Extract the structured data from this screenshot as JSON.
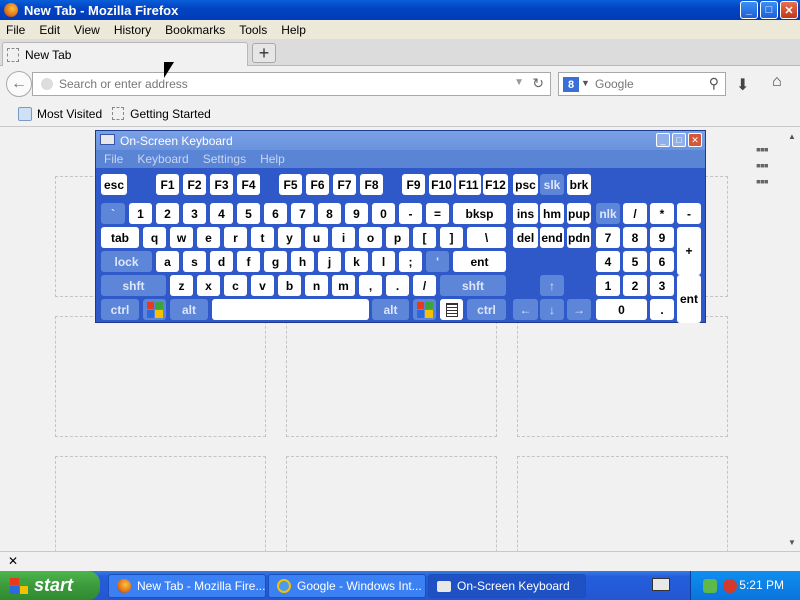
{
  "window": {
    "title": "New Tab - Mozilla Firefox"
  },
  "menu": [
    "File",
    "Edit",
    "View",
    "History",
    "Bookmarks",
    "Tools",
    "Help"
  ],
  "tab": {
    "label": "New Tab",
    "new_tab": "+"
  },
  "nav": {
    "url_placeholder": "Search or enter address",
    "search_engine": "Google",
    "search_badge": "8"
  },
  "bookmarks": [
    "Most Visited",
    "Getting Started"
  ],
  "osk": {
    "title": "On-Screen Keyboard",
    "menu": [
      "File",
      "Keyboard",
      "Settings",
      "Help"
    ],
    "keys": {
      "esc": "esc",
      "f1": "F1",
      "f2": "F2",
      "f3": "F3",
      "f4": "F4",
      "f5": "F5",
      "f6": "F6",
      "f7": "F7",
      "f8": "F8",
      "f9": "F9",
      "f10": "F10",
      "f11": "F11",
      "f12": "F12",
      "psc": "psc",
      "slk": "slk",
      "brk": "brk",
      "tick": "`",
      "k1": "1",
      "k2": "2",
      "k3": "3",
      "k4": "4",
      "k5": "5",
      "k6": "6",
      "k7": "7",
      "k8": "8",
      "k9": "9",
      "k0": "0",
      "minus": "-",
      "equals": "=",
      "bksp": "bksp",
      "ins": "ins",
      "hm": "hm",
      "pup": "pup",
      "nlk": "nlk",
      "slash": "/",
      "star": "*",
      "nminus": "-",
      "tab": "tab",
      "q": "q",
      "w": "w",
      "e": "e",
      "r": "r",
      "t": "t",
      "y": "y",
      "u": "u",
      "i": "i",
      "o": "o",
      "p": "p",
      "lbr": "[",
      "rbr": "]",
      "bslash": "\\",
      "del": "del",
      "end": "end",
      "pdn": "pdn",
      "n7": "7",
      "n8": "8",
      "n9": "9",
      "plus": "+",
      "lock": "lock",
      "a": "a",
      "s": "s",
      "d": "d",
      "f": "f",
      "g": "g",
      "h": "h",
      "j": "j",
      "k": "k",
      "l": "l",
      "semi": ";",
      "quote": "'",
      "ent": "ent",
      "n4": "4",
      "n5": "5",
      "n6": "6",
      "shft": "shft",
      "z": "z",
      "x": "x",
      "c": "c",
      "v": "v",
      "b": "b",
      "n": "n",
      "m": "m",
      "comma": ",",
      "period": ".",
      "fslash": "/",
      "rshft": "shft",
      "up": "↑",
      "n1": "1",
      "n2": "2",
      "n3": "3",
      "nent": "ent",
      "ctrl": "ctrl",
      "alt": "alt",
      "ralt": "alt",
      "rctrl": "ctrl",
      "left": "←",
      "down": "↓",
      "right": "→",
      "n0": "0",
      "ndot": "."
    }
  },
  "taskbar": {
    "start": "start",
    "tasks": [
      "New Tab - Mozilla Fire...",
      "Google - Windows Int...",
      "On-Screen Keyboard"
    ],
    "time": "5:21 PM"
  },
  "colors": {
    "xp_blue": "#245edb",
    "start_green": "#3c9a3c",
    "osk_blue": "#2f58c9"
  }
}
